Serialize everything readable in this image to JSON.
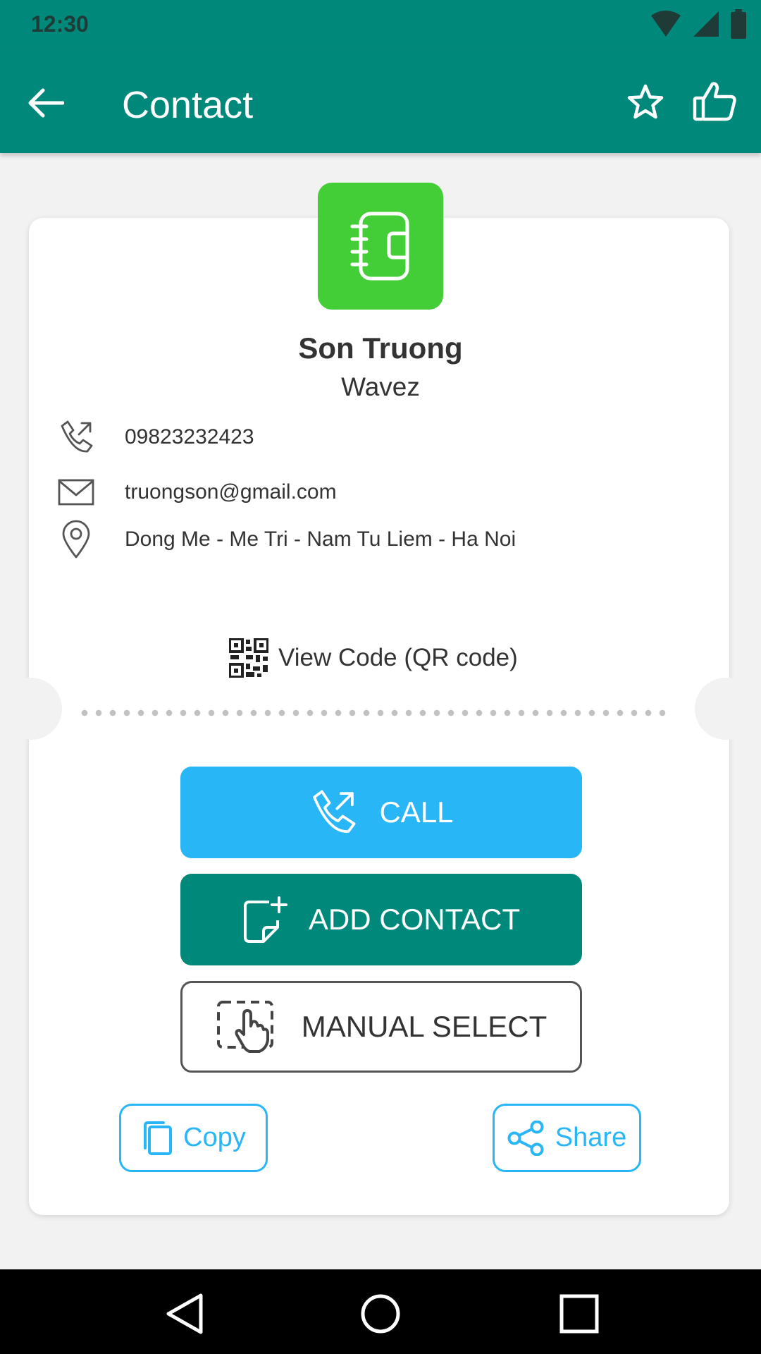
{
  "status_bar": {
    "time": "12:30"
  },
  "app_bar": {
    "title": "Contact"
  },
  "contact": {
    "name": "Son Truong",
    "company": "Wavez",
    "phone": "09823232423",
    "email": "truongson@gmail.com",
    "address": "Dong Me - Me Tri - Nam Tu Liem - Ha Noi"
  },
  "qr_link": {
    "label": "View Code (QR code)"
  },
  "actions": {
    "call_label": "CALL",
    "add_contact_label": "ADD CONTACT",
    "manual_select_label": "MANUAL SELECT",
    "copy_label": "Copy",
    "share_label": "Share"
  },
  "colors": {
    "primary": "#00897b",
    "accent": "#29b6f6",
    "logo_green": "#43cd36"
  }
}
